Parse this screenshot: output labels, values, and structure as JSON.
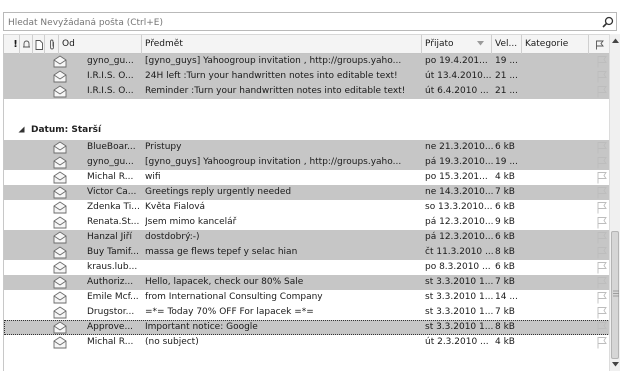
{
  "search": {
    "placeholder": "Hledat Nevyžádaná pošta (Ctrl+E)"
  },
  "headers": {
    "importance": "!",
    "from": "Od",
    "subject": "Předmět",
    "received": "Přijato",
    "size": "Vel...",
    "category": "Kategorie"
  },
  "groups": {
    "older": "Datum: Starší"
  },
  "emails_recent": [
    {
      "from": "gyno_gu...",
      "subject": "[gyno_guys] Yahoogroup invitation , http://groups.yaho...",
      "received": "po 19.4.201...",
      "size": "19 ..."
    },
    {
      "from": "I.R.I.S. O...",
      "subject": "24H left :Turn your handwritten notes into editable text!",
      "received": "út 13.4.2010...",
      "size": "21 ..."
    },
    {
      "from": "I.R.I.S. O...",
      "subject": "Reminder :Turn your handwritten notes into editable text!",
      "received": "út 6.4.2010 ...",
      "size": "21 ..."
    }
  ],
  "emails_older": [
    {
      "from": "BlueBoar...",
      "subject": "Pristupy",
      "received": "ne 21.3.2010...",
      "size": "6 kB"
    },
    {
      "from": "gyno_gu...",
      "subject": "[gyno_guys] Yahoogroup invitation , http://groups.yaho...",
      "received": "pá 19.3.2010...",
      "size": "19 ..."
    },
    {
      "from": "Michal R...",
      "subject": "wifi",
      "received": "po 15.3.201...",
      "size": "4 kB"
    },
    {
      "from": "Victor Ca...",
      "subject": "Greetings reply urgently needed",
      "received": "ne 14.3.2010...",
      "size": "7 kB"
    },
    {
      "from": "Zdenka Ti...",
      "subject": "Květa Fialová",
      "received": "so 13.3.2010...",
      "size": "6 kB"
    },
    {
      "from": "Renata.St...",
      "subject": "Jsem mimo kancelář",
      "received": "pá 12.3.2010...",
      "size": "9 kB"
    },
    {
      "from": "Hanzal Jiří",
      "subject": "dostdobrý:-)",
      "received": "pá 12.3.2010...",
      "size": "6 kB"
    },
    {
      "from": "Buy Tamif...",
      "subject": "massa ge  flews  tepef y  selac hian",
      "received": "čt 11.3.2010 ...",
      "size": "8 kB"
    },
    {
      "from": "kraus.lub...",
      "subject": "",
      "received": "po 8.3.2010 ...",
      "size": "6 kB"
    },
    {
      "from": "Authoriz...",
      "subject": "Hello, lapacek, check our 80% Sale",
      "received": "st 3.3.2010 1...",
      "size": "7 kB"
    },
    {
      "from": "Emile Mcf...",
      "subject": "from International Consulting Company",
      "received": "st 3.3.2010 1...",
      "size": "14 ..."
    },
    {
      "from": "Drugstor...",
      "subject": "=*= Today 70% OFF For lapacek =*=",
      "received": "st 3.3.2010 1...",
      "size": "7 kB"
    },
    {
      "from": "Approve...",
      "subject": "Important notice: Google",
      "received": "st 3.3.2010 1...",
      "size": "8 kB"
    },
    {
      "from": "Michal R...",
      "subject": "(no subject)",
      "received": "út 2.3.2010 ...",
      "size": "4 kB"
    }
  ],
  "colors": {
    "row_gray": "#c6c6c6",
    "row_white": "#ffffff",
    "header_bg": "#f4f4f4"
  }
}
